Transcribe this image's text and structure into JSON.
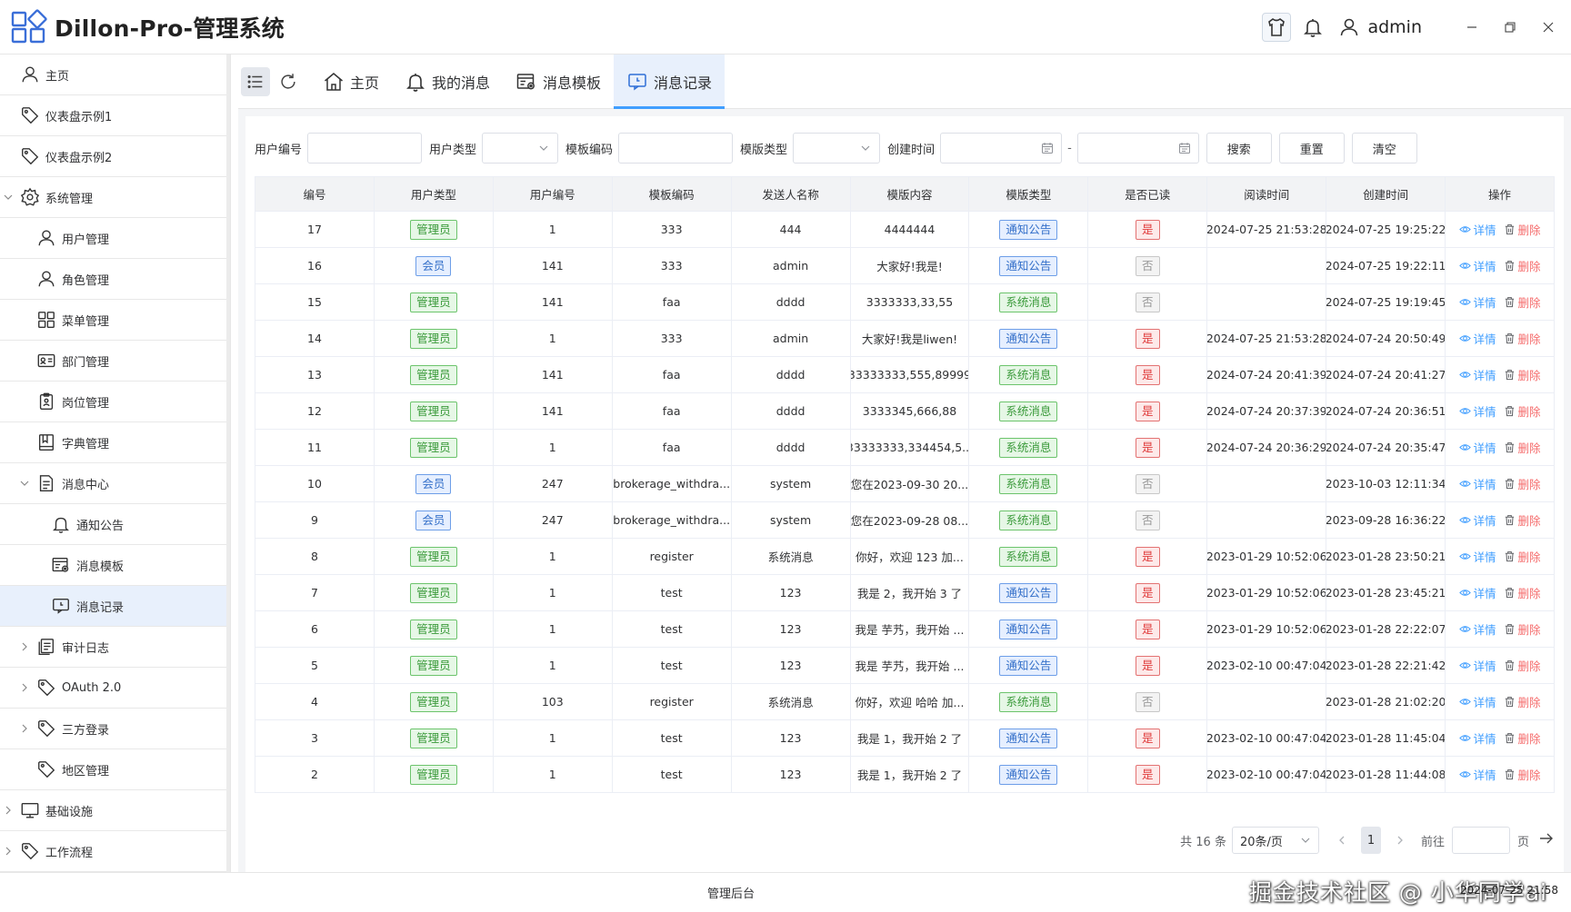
{
  "app": {
    "title": "Dillon-Pro-管理系统",
    "user": "admin"
  },
  "sidebar": {
    "items": [
      {
        "label": "主页",
        "icon": "user-icon"
      },
      {
        "label": "仪表盘示例1",
        "icon": "tag-icon"
      },
      {
        "label": "仪表盘示例2",
        "icon": "tag-icon"
      },
      {
        "label": "系统管理",
        "icon": "gear-icon"
      },
      {
        "label": "用户管理",
        "icon": "user-icon"
      },
      {
        "label": "角色管理",
        "icon": "user-icon"
      },
      {
        "label": "菜单管理",
        "icon": "grid-icon"
      },
      {
        "label": "部门管理",
        "icon": "id-card-icon"
      },
      {
        "label": "岗位管理",
        "icon": "clipboard-icon"
      },
      {
        "label": "字典管理",
        "icon": "book-icon"
      },
      {
        "label": "消息中心",
        "icon": "document-icon"
      },
      {
        "label": "通知公告",
        "icon": "bell-icon"
      },
      {
        "label": "消息模板",
        "icon": "template-icon"
      },
      {
        "label": "消息记录",
        "icon": "message-icon"
      },
      {
        "label": "审计日志",
        "icon": "log-icon"
      },
      {
        "label": "OAuth 2.0",
        "icon": "tag-icon"
      },
      {
        "label": "三方登录",
        "icon": "tag-icon"
      },
      {
        "label": "地区管理",
        "icon": "tag-icon"
      },
      {
        "label": "基础设施",
        "icon": "monitor-icon"
      },
      {
        "label": "工作流程",
        "icon": "tag-icon"
      }
    ]
  },
  "tabs": [
    {
      "label": "主页",
      "icon": "home-icon"
    },
    {
      "label": "我的消息",
      "icon": "bell-icon"
    },
    {
      "label": "消息模板",
      "icon": "template-icon"
    },
    {
      "label": "消息记录",
      "icon": "message-icon",
      "active": true
    }
  ],
  "search": {
    "user_id_label": "用户编号",
    "user_type_label": "用户类型",
    "template_code_label": "模板编码",
    "template_type_label": "模版类型",
    "created_label": "创建时间",
    "search_btn": "搜索",
    "reset_btn": "重置",
    "clear_btn": "清空",
    "range_sep": "-"
  },
  "table": {
    "headers": [
      "编号",
      "用户类型",
      "用户编号",
      "模板编码",
      "发送人名称",
      "模版内容",
      "模版类型",
      "是否已读",
      "阅读时间",
      "创建时间",
      "操作"
    ],
    "detail_label": "详情",
    "delete_label": "删除",
    "rows": [
      [
        "17",
        "管理员",
        "1",
        "333",
        "444",
        "4444444",
        "通知公告",
        "是",
        "2024-07-25 21:53:28",
        "2024-07-25 19:25:22"
      ],
      [
        "16",
        "会员",
        "141",
        "333",
        "admin",
        "大家好!我是!",
        "通知公告",
        "否",
        "",
        "2024-07-25 19:22:11"
      ],
      [
        "15",
        "管理员",
        "141",
        "faa",
        "dddd",
        "3333333,33,55",
        "系统消息",
        "否",
        "",
        "2024-07-25 19:19:45"
      ],
      [
        "14",
        "管理员",
        "1",
        "333",
        "admin",
        "大家好!我是liwen!",
        "通知公告",
        "是",
        "2024-07-25 21:53:28",
        "2024-07-24 20:50:49"
      ],
      [
        "13",
        "管理员",
        "141",
        "faa",
        "dddd",
        "33333333,555,89999",
        "系统消息",
        "是",
        "2024-07-24 20:41:39",
        "2024-07-24 20:41:27"
      ],
      [
        "12",
        "管理员",
        "141",
        "faa",
        "dddd",
        "3333345,666,88",
        "系统消息",
        "是",
        "2024-07-24 20:37:39",
        "2024-07-24 20:36:51"
      ],
      [
        "11",
        "管理员",
        "1",
        "faa",
        "dddd",
        "33333333,334454,5...",
        "系统消息",
        "是",
        "2024-07-24 20:36:29",
        "2024-07-24 20:35:47"
      ],
      [
        "10",
        "会员",
        "247",
        "brokerage_withdra...",
        "system",
        "您在2023-09-30 20...",
        "系统消息",
        "否",
        "",
        "2023-10-03 12:11:34"
      ],
      [
        "9",
        "会员",
        "247",
        "brokerage_withdra...",
        "system",
        "您在2023-09-28 08...",
        "系统消息",
        "否",
        "",
        "2023-09-28 16:36:22"
      ],
      [
        "8",
        "管理员",
        "1",
        "register",
        "系统消息",
        "你好，欢迎 123 加...",
        "系统消息",
        "是",
        "2023-01-29 10:52:06",
        "2023-01-28 23:50:21"
      ],
      [
        "7",
        "管理员",
        "1",
        "test",
        "123",
        "我是 2，我开始 3 了",
        "通知公告",
        "是",
        "2023-01-29 10:52:06",
        "2023-01-28 23:45:21"
      ],
      [
        "6",
        "管理员",
        "1",
        "test",
        "123",
        "我是 芋艿，我开始 ...",
        "通知公告",
        "是",
        "2023-01-29 10:52:06",
        "2023-01-28 22:22:07"
      ],
      [
        "5",
        "管理员",
        "1",
        "test",
        "123",
        "我是 芋艿，我开始 ...",
        "通知公告",
        "是",
        "2023-02-10 00:47:04",
        "2023-01-28 22:21:42"
      ],
      [
        "4",
        "管理员",
        "103",
        "register",
        "系统消息",
        "你好，欢迎 哈哈 加...",
        "系统消息",
        "否",
        "",
        "2023-01-28 21:02:20"
      ],
      [
        "3",
        "管理员",
        "1",
        "test",
        "123",
        "我是 1，我开始 2 了",
        "通知公告",
        "是",
        "2023-02-10 00:47:04",
        "2023-01-28 11:45:04"
      ],
      [
        "2",
        "管理员",
        "1",
        "test",
        "123",
        "我是 1，我开始 2 了",
        "通知公告",
        "是",
        "2023-02-10 00:47:04",
        "2023-01-28 11:44:08"
      ]
    ]
  },
  "pagination": {
    "total": "共 16 条",
    "page_size": "20条/页",
    "current_page": "1",
    "goto_label": "前往",
    "page_suffix": "页"
  },
  "footer": {
    "text": "管理后台",
    "watermark": "掘金技术社区 @ 小华同学ai",
    "datetime": "2024-07-25 21:58"
  },
  "colors": {
    "accent": "#409eff",
    "active_bg": "#e8f0fc",
    "tag_green": "#3a9a3a",
    "tag_blue": "#3570c9",
    "tag_red": "#e03c3c",
    "danger": "#f56c6c"
  }
}
